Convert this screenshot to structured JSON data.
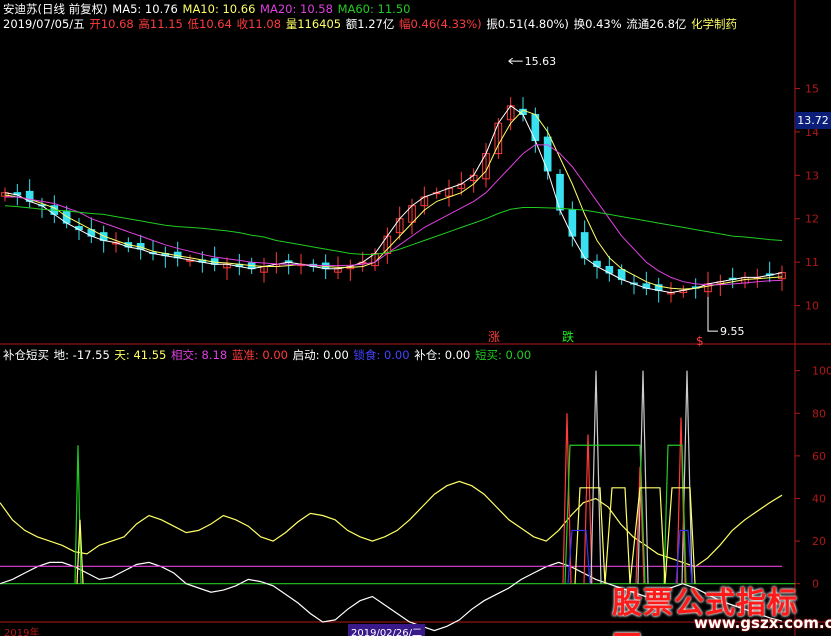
{
  "header": {
    "stock": "安迪苏(日线 前复权)",
    "ma5": "MA5: 10.76",
    "ma10": "MA10: 10.66",
    "ma20": "MA20: 10.58",
    "ma60": "MA60: 11.50",
    "date": "2019/07/05/五",
    "open": "开10.68",
    "high": "高11.15",
    "low": "低10.64",
    "close": "收11.08",
    "volume": "量116405",
    "amount": "额1.27亿",
    "change": "幅0.46(4.33%)",
    "amplitude": "振0.51(4.80%)",
    "turnover": "换0.43%",
    "float_cap": "流通26.8亿",
    "sector": "化学制药"
  },
  "indicator_header": {
    "name": "补仓短买",
    "di": "地: -17.55",
    "tian": "天: 41.55",
    "xiangjiao": "相交: 8.18",
    "lanzhun": "蓝准: 0.00",
    "qidong": "启动: 0.00",
    "suoding": "锁食: 0.00",
    "bucang": "补仓: 0.00",
    "duanmai": "短买: 0.00"
  },
  "price_tag": "13.72",
  "watermark": {
    "big": "股票公式指标网",
    "url": "www.gszx.com.cn"
  },
  "axis_bottom": {
    "left": "2019年",
    "selected_date": "2019/02/26/二"
  },
  "colors": {
    "up": "#ff3b3b",
    "down": "#38e0f0",
    "ma5": "#ffffff",
    "ma10": "#ffff66",
    "ma20": "#e040e0",
    "ma60": "#22cc22",
    "axis": "#b01818"
  },
  "chart_data": [
    {
      "type": "candlestick",
      "title": "安迪苏(日线 前复权)",
      "ylim": [
        9.3,
        16.3
      ],
      "yticks": [
        10,
        11,
        12,
        13,
        14,
        15
      ],
      "annotations": [
        {
          "label": "15.63",
          "price": 15.63
        },
        {
          "label": "9.55",
          "price": 9.55
        },
        {
          "label": "涨",
          "color": "#ff3b3b"
        },
        {
          "label": "跌",
          "color": "#22ee22"
        },
        {
          "label": "$",
          "color": "#ff3b3b"
        }
      ],
      "series": [
        {
          "name": "MA5",
          "color": "#ffffff",
          "values": [
            12.6,
            12.55,
            12.4,
            12.3,
            12.1,
            11.9,
            11.75,
            11.6,
            11.5,
            11.45,
            11.35,
            11.3,
            11.2,
            11.15,
            11.1,
            11.05,
            11.0,
            10.95,
            10.95,
            10.9,
            10.85,
            10.9,
            10.95,
            11.0,
            10.95,
            10.9,
            10.85,
            10.85,
            10.9,
            11.0,
            11.2,
            11.6,
            12.0,
            12.3,
            12.5,
            12.6,
            12.7,
            12.8,
            13.0,
            13.5,
            14.2,
            14.6,
            14.4,
            13.8,
            13.1,
            12.2,
            11.6,
            11.1,
            10.9,
            10.75,
            10.6,
            10.5,
            10.4,
            10.35,
            10.3,
            10.35,
            10.4,
            10.5,
            10.55,
            10.6,
            10.65,
            10.65,
            10.7,
            10.76
          ]
        },
        {
          "name": "MA10",
          "color": "#ffff66",
          "values": [
            12.55,
            12.5,
            12.45,
            12.35,
            12.25,
            12.05,
            11.9,
            11.75,
            11.6,
            11.5,
            11.4,
            11.35,
            11.25,
            11.2,
            11.15,
            11.1,
            11.05,
            11.0,
            10.98,
            10.95,
            10.92,
            10.9,
            10.9,
            10.92,
            10.95,
            10.93,
            10.9,
            10.88,
            10.88,
            10.9,
            11.0,
            11.3,
            11.6,
            11.9,
            12.2,
            12.4,
            12.5,
            12.6,
            12.8,
            13.1,
            13.7,
            14.2,
            14.5,
            14.4,
            14.0,
            13.4,
            12.8,
            12.1,
            11.5,
            11.1,
            10.85,
            10.7,
            10.55,
            10.45,
            10.4,
            10.38,
            10.4,
            10.45,
            10.5,
            10.55,
            10.6,
            10.62,
            10.64,
            10.66
          ]
        },
        {
          "name": "MA20",
          "color": "#e040e0",
          "values": [
            12.5,
            12.5,
            12.45,
            12.4,
            12.35,
            12.25,
            12.15,
            12.0,
            11.9,
            11.8,
            11.7,
            11.6,
            11.5,
            11.4,
            11.32,
            11.25,
            11.18,
            11.12,
            11.08,
            11.04,
            11.0,
            10.98,
            10.96,
            10.95,
            10.94,
            10.93,
            10.92,
            10.92,
            10.93,
            10.95,
            11.0,
            11.2,
            11.4,
            11.6,
            11.8,
            11.95,
            12.1,
            12.25,
            12.4,
            12.6,
            12.9,
            13.2,
            13.5,
            13.7,
            13.7,
            13.5,
            13.2,
            12.8,
            12.4,
            12.0,
            11.6,
            11.3,
            11.0,
            10.8,
            10.65,
            10.55,
            10.5,
            10.48,
            10.48,
            10.5,
            10.52,
            10.55,
            10.57,
            10.58
          ]
        },
        {
          "name": "MA60",
          "color": "#22cc22",
          "values": [
            12.3,
            12.28,
            12.25,
            12.22,
            12.2,
            12.18,
            12.15,
            12.12,
            12.1,
            12.05,
            12.0,
            11.95,
            11.9,
            11.85,
            11.82,
            11.8,
            11.78,
            11.75,
            11.72,
            11.68,
            11.62,
            11.58,
            11.5,
            11.45,
            11.4,
            11.35,
            11.3,
            11.25,
            11.2,
            11.18,
            11.18,
            11.22,
            11.3,
            11.4,
            11.5,
            11.6,
            11.7,
            11.8,
            11.9,
            12.0,
            12.12,
            12.22,
            12.26,
            12.26,
            12.25,
            12.24,
            12.22,
            12.2,
            12.15,
            12.1,
            12.05,
            12.0,
            11.95,
            11.9,
            11.85,
            11.8,
            11.75,
            11.7,
            11.65,
            11.6,
            11.58,
            11.55,
            11.52,
            11.5
          ]
        }
      ]
    },
    {
      "type": "line",
      "title": "补仓短买",
      "ylim": [
        -10,
        105
      ],
      "yticks": [
        0,
        20,
        40,
        60,
        80,
        100
      ],
      "series": [
        {
          "name": "天",
          "color": "#ffff66",
          "values": [
            38,
            30,
            25,
            22,
            20,
            18,
            15,
            14,
            18,
            20,
            22,
            28,
            32,
            30,
            27,
            24,
            25,
            28,
            32,
            30,
            27,
            22,
            20,
            24,
            29,
            33,
            32,
            30,
            25,
            22,
            20,
            22,
            25,
            30,
            36,
            42,
            46,
            48,
            46,
            42,
            36,
            30,
            26,
            22,
            20,
            25,
            32,
            38,
            40,
            36,
            28,
            22,
            18,
            14,
            12,
            10,
            8,
            12,
            18,
            25,
            30,
            34,
            38,
            41.55
          ]
        },
        {
          "name": "地",
          "color": "#ffffff",
          "values": [
            0,
            2,
            5,
            8,
            10,
            10,
            8,
            5,
            2,
            3,
            6,
            9,
            10,
            8,
            5,
            0,
            -2,
            -4,
            -3,
            -1,
            2,
            1,
            -1,
            -5,
            -9,
            -14,
            -18,
            -17,
            -12,
            -8,
            -6,
            -10,
            -14,
            -18,
            -20,
            -22,
            -20,
            -17,
            -12,
            -8,
            -5,
            -2,
            2,
            5,
            8,
            10,
            8,
            5,
            2,
            0,
            -2,
            -4,
            -6,
            -4,
            -2,
            0,
            -2,
            -5,
            -8,
            -10,
            -12,
            -14,
            -16,
            -17.55
          ]
        },
        {
          "name": "相交",
          "color": "#e040e0",
          "values": [
            8.18,
            8.18,
            8.18,
            8.18,
            8.18,
            8.18,
            8.18,
            8.18,
            8.18,
            8.18,
            8.18,
            8.18,
            8.18,
            8.18,
            8.18,
            8.18,
            8.18,
            8.18,
            8.18,
            8.18,
            8.18,
            8.18,
            8.18,
            8.18,
            8.18,
            8.18,
            8.18,
            8.18,
            8.18,
            8.18,
            8.18,
            8.18,
            8.18,
            8.18,
            8.18,
            8.18,
            8.18,
            8.18,
            8.18,
            8.18,
            8.18,
            8.18,
            8.18,
            8.18,
            8.18,
            8.18,
            8.18,
            8.18,
            8.18,
            8.18,
            8.18,
            8.18,
            8.18,
            8.18,
            8.18,
            8.18,
            8.18,
            8.18,
            8.18,
            8.18,
            8.18,
            8.18,
            8.18,
            8.18
          ]
        }
      ]
    }
  ]
}
